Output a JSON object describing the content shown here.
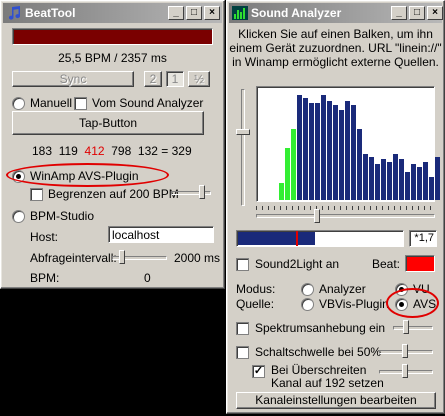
{
  "beattool": {
    "title": "BeatTool",
    "title_buttons": {
      "minimize": "_",
      "maximize": "□",
      "close": "×"
    },
    "bpm_readout": "25,5 BPM / 2357 ms",
    "sync_label": "Sync",
    "divider_buttons": [
      "2",
      "1",
      "½"
    ],
    "manuell_label": "Manuell",
    "vom_sound_label": "Vom Sound Analyzer",
    "tap_button_label": "Tap-Button",
    "tap_numbers": {
      "a": "183",
      "b": "119",
      "c": "412",
      "d": "798",
      "e": "132 = 329"
    },
    "winamp_label": "WinAmp AVS-Plugin",
    "begrenzen_label": "Begrenzen auf 200 BPM",
    "bpm_studio_label": "BPM-Studio",
    "host_label": "Host:",
    "host_value": "localhost",
    "abfrage_label": "Abfrageintervall:",
    "abfrage_value": "2000 ms",
    "bpm_label": "BPM:",
    "bpm_value": "0"
  },
  "analyzer": {
    "title": "Sound Analyzer",
    "title_buttons": {
      "minimize": "_",
      "maximize": "□",
      "close": "×"
    },
    "info_line1": "Klicken Sie auf einen Balken, um ihn",
    "info_line2": "einem Gerät zuzuordnen. URL \"linein://\"",
    "info_line3": "in Winamp ermöglicht externe Quellen.",
    "spectrum": {
      "green_levels": [
        0.15,
        0.46,
        0.63
      ],
      "blue_levels": [
        0.93,
        0.9,
        0.86,
        0.86,
        0.93,
        0.88,
        0.84,
        0.8,
        0.88,
        0.84,
        0.63,
        0.41,
        0.38,
        0.32,
        0.36,
        0.34,
        0.41,
        0.36,
        0.25,
        0.32,
        0.29,
        0.34,
        0.2,
        0.38
      ],
      "colors": {
        "green": "#33ee33",
        "blue": "#1a2a7a",
        "background": "#ffffff"
      }
    },
    "level_fill": 0.47,
    "level_marker": 0.36,
    "level_value": "*1,7",
    "sound2light_label": "Sound2Light an",
    "beat_label": "Beat:",
    "beat_color": "#ff0000",
    "modus_label": "Modus:",
    "quelle_label": "Quelle:",
    "analyzer_label": "Analyzer",
    "vu_label": "VU",
    "vbvis_label": "VBVis-Plugin",
    "avs_label": "AVS",
    "spektrum_label": "Spektrumsanhebung ein",
    "schalt_label": "Schaltschwelle bei 50%",
    "ueber_line1": "Bei Überschreiten",
    "ueber_line2": "Kanal auf 192 setzen",
    "kanal_button": "Kanaleinstellungen bearbeiten"
  },
  "highlight_color": "#e00000"
}
